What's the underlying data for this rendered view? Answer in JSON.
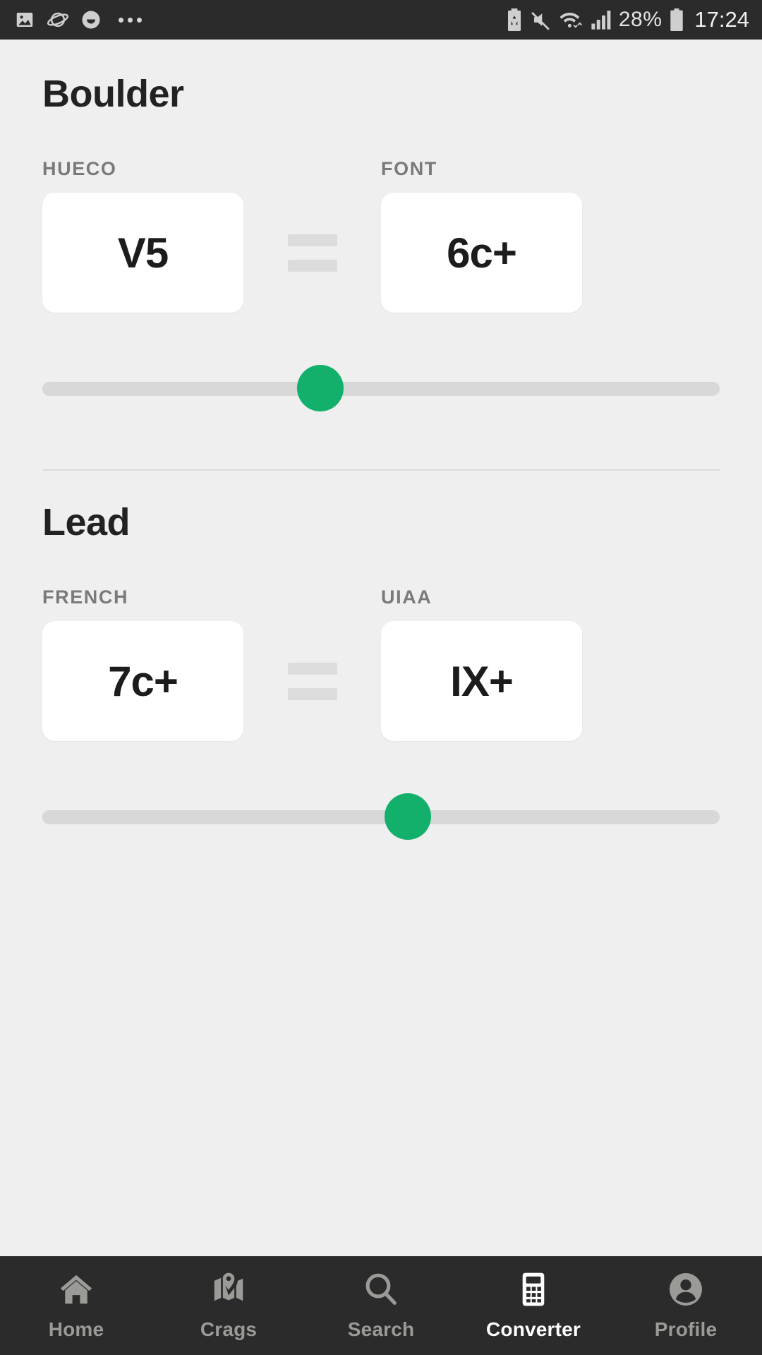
{
  "status_bar": {
    "left_icons": [
      "photo-icon",
      "opera-planet-icon",
      "smiley-icon",
      "overflow-dots-icon"
    ],
    "right_icons": [
      "battery-saver-icon",
      "volume-mute-icon",
      "wifi-icon",
      "cellular-signal-icon",
      "battery-icon"
    ],
    "battery_percent": "28%",
    "clock": "17:24"
  },
  "boulder": {
    "title": "Boulder",
    "left_label": "HUECO",
    "right_label": "FONT",
    "left_value": "V5",
    "right_value": "6c+",
    "equals_icon": "equals-icon",
    "slider_percent": 41
  },
  "lead": {
    "title": "Lead",
    "left_label": "FRENCH",
    "right_label": "UIAA",
    "left_value": "7c+",
    "right_value": "IX+",
    "equals_icon": "equals-icon",
    "slider_percent": 54
  },
  "colors": {
    "accent_green": "#13b06c",
    "background": "#efefef",
    "card": "#ffffff",
    "nav_background": "#2b2b2b",
    "nav_inactive": "#9a9a97",
    "nav_active": "#ffffff"
  },
  "bottom_nav": {
    "items": [
      {
        "label": "Home",
        "icon": "home-icon",
        "active": false
      },
      {
        "label": "Crags",
        "icon": "map-pin-icon",
        "active": false
      },
      {
        "label": "Search",
        "icon": "search-icon",
        "active": false
      },
      {
        "label": "Converter",
        "icon": "calculator-icon",
        "active": true
      },
      {
        "label": "Profile",
        "icon": "person-icon",
        "active": false
      }
    ]
  }
}
